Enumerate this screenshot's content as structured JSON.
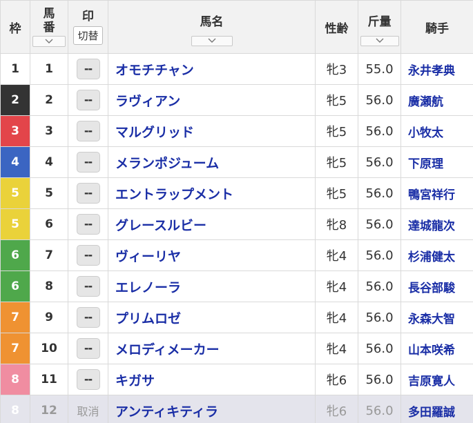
{
  "headers": {
    "waku": "枠",
    "umaban_top": "馬",
    "umaban_bottom": "番",
    "mark": "印",
    "mark_switch": "切替",
    "name": "馬名",
    "sex_age": "性齢",
    "weight": "斤量",
    "jockey": "騎手"
  },
  "rows": [
    {
      "waku": "1",
      "umaban": "1",
      "mark": "--",
      "name": "オモチチャン",
      "sex_age": "牝3",
      "weight": "55.0",
      "jockey": "永井孝典",
      "scratched": false
    },
    {
      "waku": "2",
      "umaban": "2",
      "mark": "--",
      "name": "ラヴィアン",
      "sex_age": "牝5",
      "weight": "56.0",
      "jockey": "廣瀬航",
      "scratched": false
    },
    {
      "waku": "3",
      "umaban": "3",
      "mark": "--",
      "name": "マルグリッド",
      "sex_age": "牝5",
      "weight": "56.0",
      "jockey": "小牧太",
      "scratched": false
    },
    {
      "waku": "4",
      "umaban": "4",
      "mark": "--",
      "name": "メランポジューム",
      "sex_age": "牝5",
      "weight": "56.0",
      "jockey": "下原理",
      "scratched": false
    },
    {
      "waku": "5",
      "umaban": "5",
      "mark": "--",
      "name": "エントラップメント",
      "sex_age": "牝5",
      "weight": "56.0",
      "jockey": "鴨宮祥行",
      "scratched": false
    },
    {
      "waku": "5",
      "umaban": "6",
      "mark": "--",
      "name": "グレースルビー",
      "sex_age": "牝8",
      "weight": "56.0",
      "jockey": "達城龍次",
      "scratched": false
    },
    {
      "waku": "6",
      "umaban": "7",
      "mark": "--",
      "name": "ヴィーリヤ",
      "sex_age": "牝4",
      "weight": "56.0",
      "jockey": "杉浦健太",
      "scratched": false
    },
    {
      "waku": "6",
      "umaban": "8",
      "mark": "--",
      "name": "エレノーラ",
      "sex_age": "牝4",
      "weight": "56.0",
      "jockey": "長谷部駿",
      "scratched": false
    },
    {
      "waku": "7",
      "umaban": "9",
      "mark": "--",
      "name": "プリムロゼ",
      "sex_age": "牝4",
      "weight": "56.0",
      "jockey": "永森大智",
      "scratched": false
    },
    {
      "waku": "7",
      "umaban": "10",
      "mark": "--",
      "name": "メロディメーカー",
      "sex_age": "牝4",
      "weight": "56.0",
      "jockey": "山本咲希",
      "scratched": false
    },
    {
      "waku": "8",
      "umaban": "11",
      "mark": "--",
      "name": "キガサ",
      "sex_age": "牝6",
      "weight": "56.0",
      "jockey": "吉原寛人",
      "scratched": false
    },
    {
      "waku": "8",
      "umaban": "12",
      "mark": "取消",
      "name": "アンティキティラ",
      "sex_age": "牝6",
      "weight": "56.0",
      "jockey": "多田羅誠",
      "scratched": true
    }
  ],
  "waku_colors": {
    "1": "#ffffff",
    "2": "#333333",
    "3": "#e3454a",
    "4": "#3b65c2",
    "5": "#ead23a",
    "6": "#4fa84b",
    "7": "#ef9232",
    "8": "#f08da1"
  },
  "icons": {
    "sort": "chevron-down-icon"
  }
}
